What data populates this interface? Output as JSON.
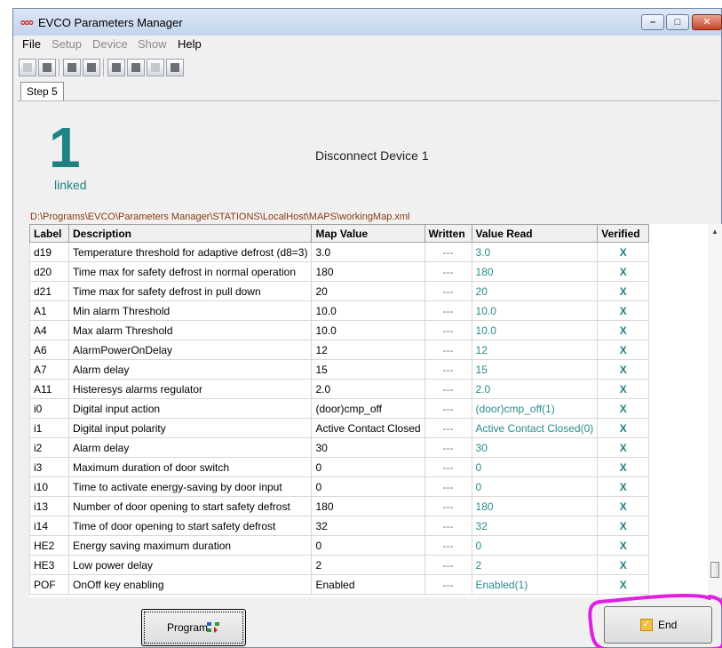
{
  "window": {
    "app_icon": "ᴑᴑᴑ",
    "title": "EVCO Parameters Manager",
    "controls": [
      "–",
      "□",
      "✕"
    ]
  },
  "menu": [
    {
      "label": "File",
      "enabled": true
    },
    {
      "label": "Setup",
      "enabled": false
    },
    {
      "label": "Device",
      "enabled": false
    },
    {
      "label": "Show",
      "enabled": false
    },
    {
      "label": "Help",
      "enabled": true
    }
  ],
  "tab": {
    "label": "Step 5"
  },
  "device": {
    "count": "1",
    "count_label": "linked",
    "status": "Disconnect Device 1",
    "map_path": "D:\\Programs\\EVCO\\Parameters Manager\\STATIONS\\LocalHost\\MAPS\\workingMap.xml"
  },
  "table": {
    "columns": [
      "Label",
      "Description",
      "Map Value",
      "Written",
      "Value Read",
      "Verified"
    ],
    "rows": [
      [
        "d19",
        "Temperature threshold for adaptive defrost (d8=3)",
        "3.0",
        "---",
        "3.0",
        "X"
      ],
      [
        "d20",
        "Time max for safety defrost in normal operation",
        "180",
        "---",
        "180",
        "X"
      ],
      [
        "d21",
        "Time max for safety defrost in pull down",
        "20",
        "---",
        "20",
        "X"
      ],
      [
        "A1",
        "Min alarm Threshold",
        "10.0",
        "---",
        "10.0",
        "X"
      ],
      [
        "A4",
        "Max alarm Threshold",
        "10.0",
        "---",
        "10.0",
        "X"
      ],
      [
        "A6",
        "AlarmPowerOnDelay",
        "12",
        "---",
        "12",
        "X"
      ],
      [
        "A7",
        "Alarm delay",
        "15",
        "---",
        "15",
        "X"
      ],
      [
        "A11",
        "Histeresys alarms regulator",
        "2.0",
        "---",
        "2.0",
        "X"
      ],
      [
        "i0",
        "Digital input action",
        "(door)cmp_off",
        "---",
        "(door)cmp_off(1)",
        "X"
      ],
      [
        "i1",
        "Digital input polarity",
        "Active Contact Closed",
        "---",
        "Active Contact Closed(0)",
        "X"
      ],
      [
        "i2",
        "Alarm delay",
        "30",
        "---",
        "30",
        "X"
      ],
      [
        "i3",
        "Maximum duration of door switch",
        "0",
        "---",
        "0",
        "X"
      ],
      [
        "i10",
        "Time to activate energy-saving by door input",
        "0",
        "---",
        "0",
        "X"
      ],
      [
        "i13",
        "Number of door opening to start safety defrost",
        "180",
        "---",
        "180",
        "X"
      ],
      [
        "i14",
        "Time of door opening to start safety defrost",
        "32",
        "---",
        "32",
        "X"
      ],
      [
        "HE2",
        "Energy saving maximum duration",
        "0",
        "---",
        "0",
        "X"
      ],
      [
        "HE3",
        "Low power delay",
        "2",
        "---",
        "2",
        "X"
      ],
      [
        "POF",
        "OnOff key enabling",
        "Enabled",
        "---",
        "Enabled(1)",
        "X"
      ]
    ]
  },
  "buttons": {
    "program": "Program",
    "end": "End"
  },
  "colors": {
    "accent": "#1e8282",
    "path": "#8a3a10",
    "annotation": "#e020e0"
  },
  "icons": [
    "app-logo-icon",
    "minimize-icon",
    "maximize-icon",
    "close-icon",
    "program-transfer-icon",
    "checkmark-icon",
    "scroll-up-icon"
  ]
}
